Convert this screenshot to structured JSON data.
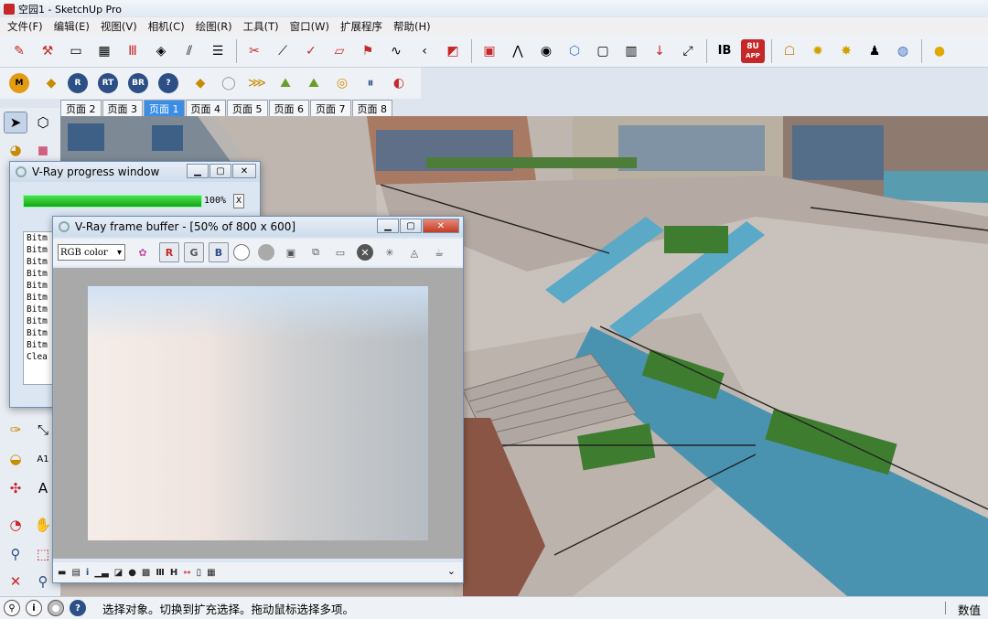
{
  "window": {
    "title": "空园1 - SketchUp Pro"
  },
  "menu": [
    "文件(F)",
    "编辑(E)",
    "视图(V)",
    "相机(C)",
    "绘图(R)",
    "工具(T)",
    "窗口(W)",
    "扩展程序",
    "帮助(H)"
  ],
  "toolbar_round": [
    "M",
    "R",
    "RT",
    "BR",
    "?"
  ],
  "toolbar_labels": {
    "ib": "IB",
    "su": "8U",
    "su_sub": "APP"
  },
  "tabs": [
    "页面 2",
    "页面 3",
    "页面 1",
    "页面 4",
    "页面 5",
    "页面 6",
    "页面 7",
    "页面 8"
  ],
  "active_tab": "页面 1",
  "progress_window": {
    "title": "V-Ray progress window",
    "progress_percent": 100,
    "progress_label": "100%",
    "close_label": "X",
    "log": [
      "Bitm",
      "Bitm",
      "Bitm",
      "Bitm",
      "Bitm",
      "Bitm",
      "Bitm",
      "Bitm",
      "Bitm",
      "Bitm",
      "Clea"
    ]
  },
  "frame_buffer": {
    "title": "V-Ray frame buffer - [50% of 800 x 600]",
    "channel_select": "RGB color",
    "channels": [
      "R",
      "G",
      "B"
    ],
    "bottom_tools": [
      "i",
      "H"
    ]
  },
  "status": {
    "text": "选择对象。切换到扩充选择。拖动鼠标选择多项。",
    "right_label": "数值"
  },
  "colors": {
    "accent": "#3a8ee6",
    "progress": "#16a516",
    "close": "#c43c25"
  }
}
